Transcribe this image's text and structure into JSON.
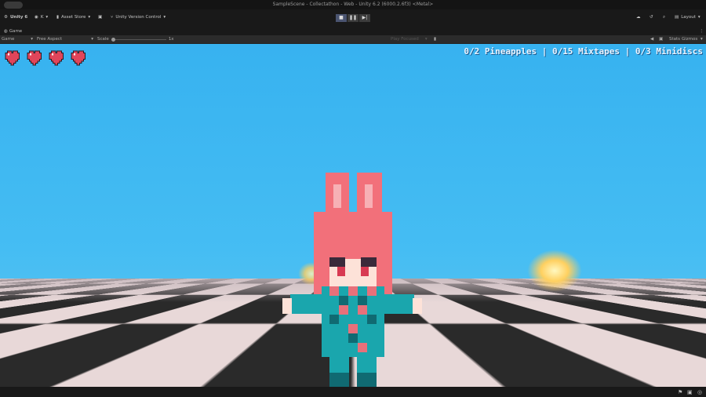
{
  "window": {
    "title": "SampleScene - Collectathon - Web - Unity 6.2 (6000.2.6f3) <Metal>"
  },
  "toolbar": {
    "unity_label": "Unity 6",
    "account_label": "K",
    "asset_store_label": "Asset Store",
    "version_control_label": "Unity Version Control",
    "layout_label": "Layout"
  },
  "tab": {
    "label": "Game"
  },
  "gamebar": {
    "display": "Game",
    "aspect": "Free Aspect",
    "scale_label": "Scale",
    "scale_value": "1x",
    "play_focused": "Play Focused",
    "stats": "Stats",
    "gizmos": "Gizmos",
    "scale_fraction": 0
  },
  "hud": {
    "hearts": 4,
    "counter": "0/2 Pineapples | 0/15 Mixtapes | 0/3 Minidiscs"
  },
  "colors": {
    "sky": "#3fb8f2",
    "heart": "#e0455a",
    "hair": "#f2707a",
    "outfit": "#1aa6ad"
  }
}
